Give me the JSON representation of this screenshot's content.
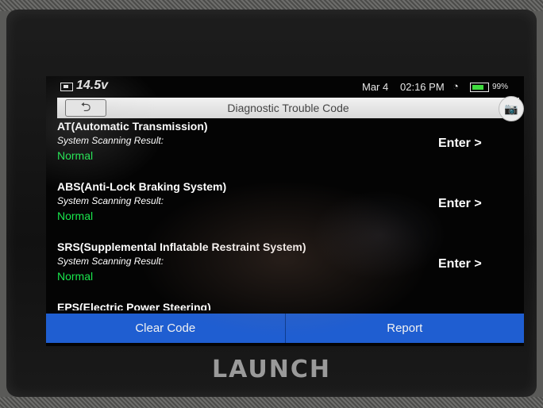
{
  "status_bar": {
    "voltage": "14.5v",
    "date": "Mar 4",
    "time": "02:16 PM",
    "battery": "99%"
  },
  "title_bar": {
    "back_icon": "⮌",
    "title": "Diagnostic Trouble Code",
    "camera_icon": "📷"
  },
  "systems": [
    {
      "name": "AT(Automatic Transmission)",
      "scan_label": "System Scanning Result:",
      "status": "Normal",
      "enter": "Enter >"
    },
    {
      "name": "ABS(Anti-Lock Braking System)",
      "scan_label": "System Scanning Result:",
      "status": "Normal",
      "enter": "Enter >"
    },
    {
      "name": "SRS(Supplemental Inflatable Restraint System)",
      "scan_label": "System Scanning Result:",
      "status": "Normal",
      "enter": "Enter >"
    },
    {
      "name": "EPS(Electric Power Steering)"
    }
  ],
  "actions": {
    "clear_code": "Clear Code",
    "report": "Report"
  },
  "brand": "LAUNCH"
}
